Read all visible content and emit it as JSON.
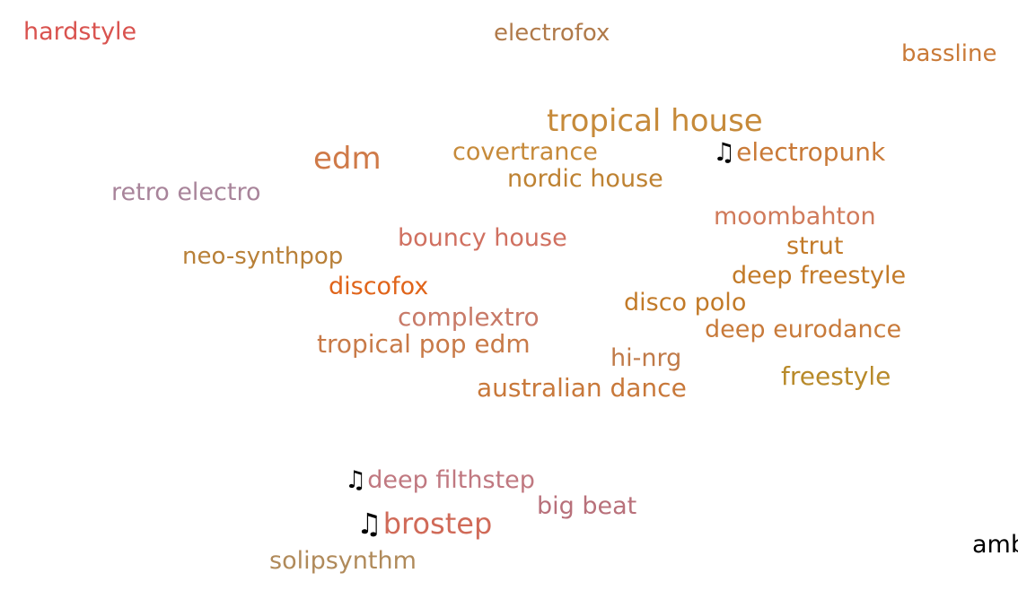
{
  "genres": [
    {
      "label": "hardstyle",
      "color": "#d9534f"
    },
    {
      "label": "electrofox",
      "color": "#b07a4a"
    },
    {
      "label": "bassline",
      "color": "#c97a38"
    },
    {
      "label": "tropical house",
      "color": "#c68a3a"
    },
    {
      "label": "edm",
      "color": "#cf7a48"
    },
    {
      "label": "covertrance",
      "color": "#c68a3a"
    },
    {
      "label": "electropunk",
      "color": "#c97a38",
      "note": "♫"
    },
    {
      "label": "nordic house",
      "color": "#be8232"
    },
    {
      "label": "retro electro",
      "color": "#a8849a"
    },
    {
      "label": "moombahton",
      "color": "#d07a5a"
    },
    {
      "label": "bouncy house",
      "color": "#d07060"
    },
    {
      "label": "strut",
      "color": "#c27a28"
    },
    {
      "label": "neo-synthpop",
      "color": "#b88038"
    },
    {
      "label": "deep freestyle",
      "color": "#c27a28"
    },
    {
      "label": "discofox",
      "color": "#e0641a"
    },
    {
      "label": "disco polo",
      "color": "#c27a28"
    },
    {
      "label": "complextro",
      "color": "#c87a68"
    },
    {
      "label": "deep eurodance",
      "color": "#c87a3a"
    },
    {
      "label": "tropical pop edm",
      "color": "#c87a48"
    },
    {
      "label": "hi-nrg",
      "color": "#c07a48"
    },
    {
      "label": "australian dance",
      "color": "#c8783a"
    },
    {
      "label": "freestyle",
      "color": "#b88a2a"
    },
    {
      "label": "deep filthstep",
      "color": "#c07880",
      "note": "♫"
    },
    {
      "label": "big beat",
      "color": "#b8707a"
    },
    {
      "label": "brostep",
      "color": "#d06a58",
      "note": "♫"
    },
    {
      "label": "solipsynthm",
      "color": "#b08a5a"
    },
    {
      "label": "amb",
      "color": "#000000"
    }
  ]
}
